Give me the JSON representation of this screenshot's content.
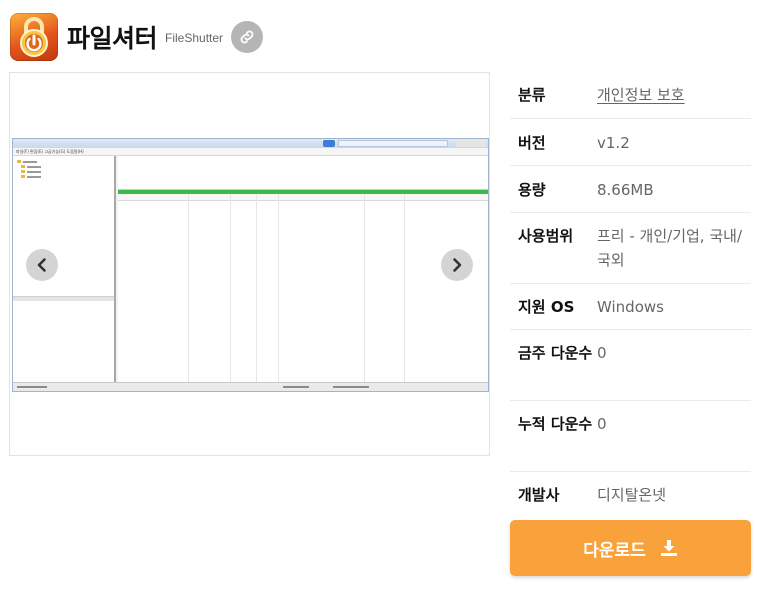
{
  "header": {
    "title": "파일셔터",
    "subtitle": "FileShutter",
    "icon": "padlock-icon",
    "link_icon": "link-icon"
  },
  "gallery": {
    "prev_icon": "chevron-left-icon",
    "next_icon": "chevron-right-icon",
    "screenshot": {
      "menu": "파일(F)   편집(E)   고급기능(G)   도움말(H)"
    }
  },
  "info": {
    "rows": [
      {
        "label": "분류",
        "value": "개인정보 보호"
      },
      {
        "label": "버전",
        "value": "v1.2"
      },
      {
        "label": "용량",
        "value": "8.66MB"
      },
      {
        "label": "사용범위",
        "value": "프리 - 개인/기업, 국내/국외"
      },
      {
        "label": "지원 OS",
        "value": "Windows"
      },
      {
        "label": "금주 다운수",
        "value": "0"
      },
      {
        "label": "누적 다운수",
        "value": "0"
      },
      {
        "label": "개발사",
        "value": "디지탈온넷"
      }
    ]
  },
  "download": {
    "label": "다운로드",
    "icon": "download-icon"
  },
  "colors": {
    "accent": "#f9a13a",
    "link_button": "#b5b5b5"
  }
}
